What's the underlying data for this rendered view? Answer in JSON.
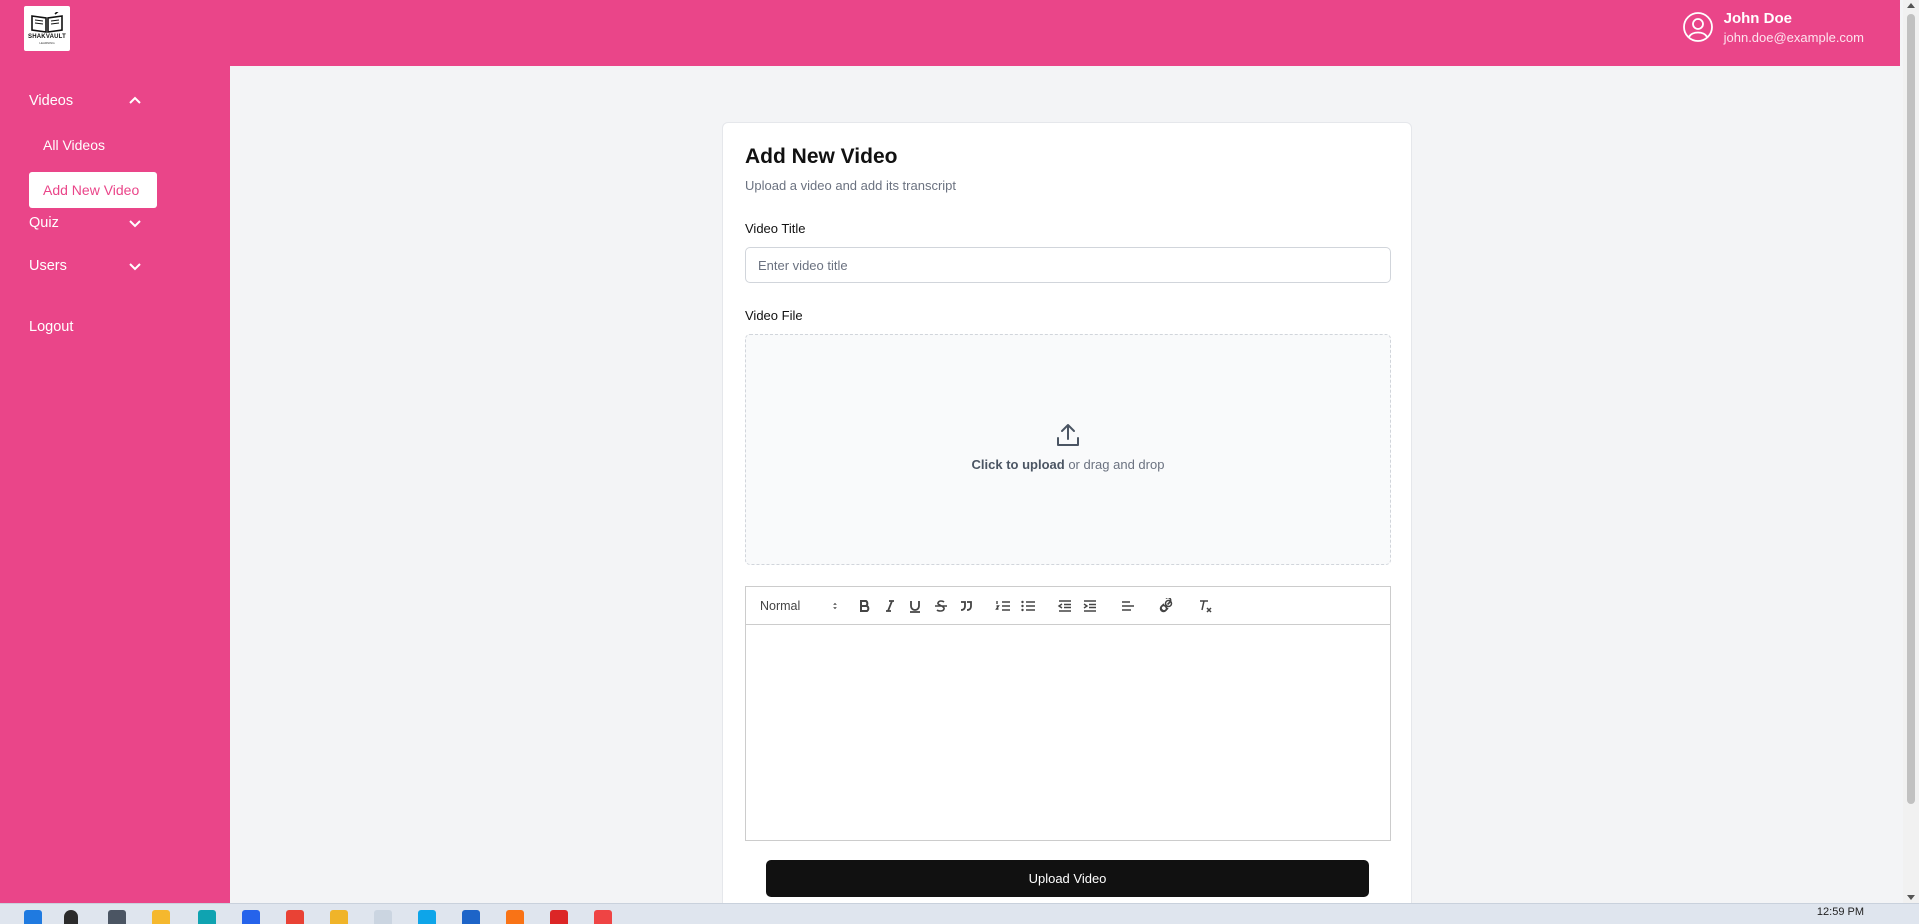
{
  "header": {
    "logo_text": "SHAKVAULT",
    "logo_subtext": "LEARNING",
    "user_name": "John Doe",
    "user_email": "john.doe@example.com"
  },
  "sidebar": {
    "videos_label": "Videos",
    "all_videos_label": "All Videos",
    "add_new_video_label": "Add New Video",
    "quiz_label": "Quiz",
    "users_label": "Users",
    "logout_label": "Logout"
  },
  "form": {
    "title": "Add New Video",
    "subtitle": "Upload a video and add its transcript",
    "video_title_label": "Video Title",
    "video_title_placeholder": "Enter video title",
    "video_file_label": "Video File",
    "upload_click_text": "Click to upload",
    "upload_drag_text": " or drag and drop",
    "editor_header_select": "Normal",
    "submit_label": "Upload Video"
  },
  "taskbar": {
    "clock": "12:59 PM"
  },
  "colors": {
    "brand": "#ea4589",
    "button": "#111111"
  }
}
